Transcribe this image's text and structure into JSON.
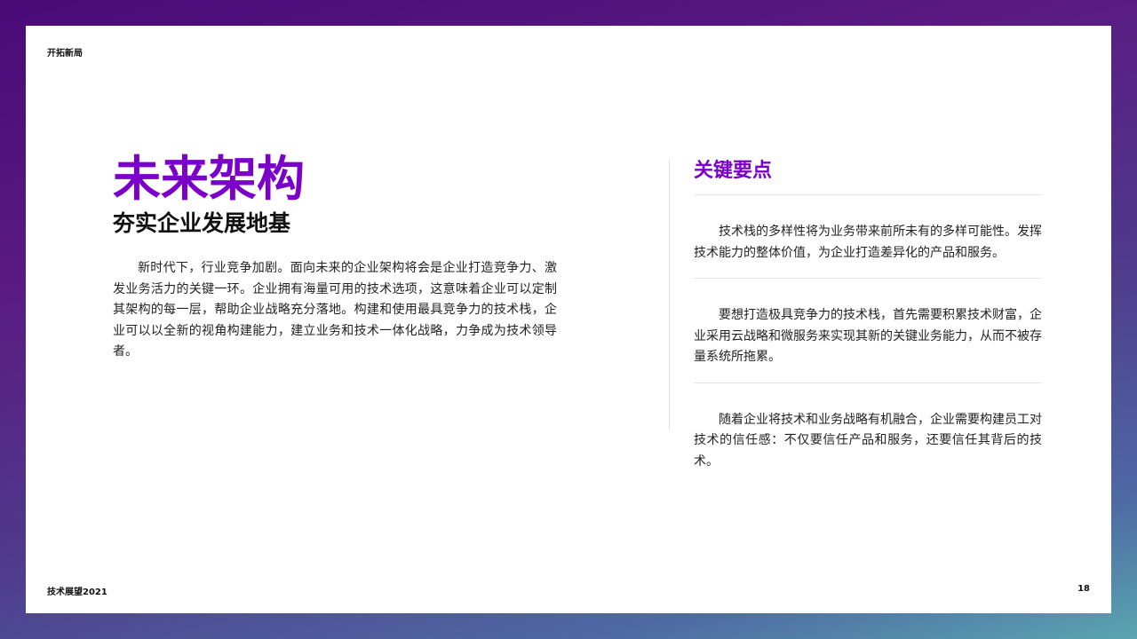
{
  "header": {
    "section_label": "开拓新局"
  },
  "main": {
    "title": "未来架构",
    "subtitle": "夯实企业发展地基",
    "body": "新时代下，行业竞争加剧。面向未来的企业架构将会是企业打造竞争力、激发业务活力的关键一环。企业拥有海量可用的技术选项，这意味着企业可以定制其架构的每一层，帮助企业战略充分落地。构建和使用最具竞争力的技术栈，企业可以以全新的视角构建能力，建立业务和技术一体化战略，力争成为技术领导者。"
  },
  "key_points": {
    "title": "关键要点",
    "items": [
      "技术栈的多样性将为业务带来前所未有的多样可能性。发挥技术能力的整体价值，为企业打造差异化的产品和服务。",
      "要想打造极具竞争力的技术栈，首先需要积累技术财富，企业采用云战略和微服务来实现其新的关键业务能力，从而不被存量系统所拖累。",
      "随着企业将技术和业务战略有机融合，企业需要构建员工对技术的信任感：不仅要信任产品和服务，还要信任其背后的技术。"
    ]
  },
  "footer": {
    "publication": "技术展望2021",
    "page_number": "18"
  },
  "colors": {
    "accent": "#7b00c9",
    "frame_top": "#4a0a78",
    "frame_bottom": "#5aa5b0"
  }
}
